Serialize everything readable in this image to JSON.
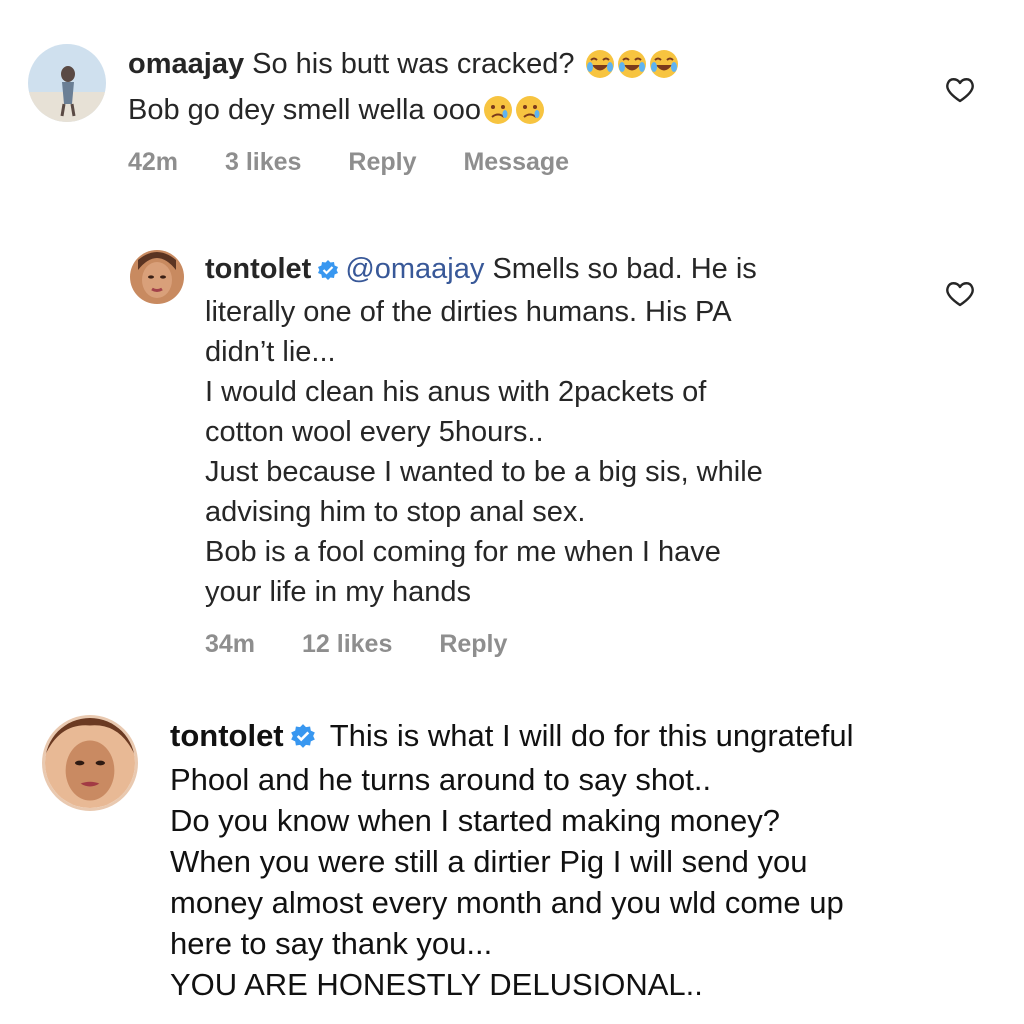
{
  "comments": [
    {
      "username": "omaajay",
      "lines": [
        "So his butt was cracked?",
        "Bob go dey smell wella ooo"
      ],
      "emoji_line1": [
        "joy-emoji",
        "joy-emoji",
        "joy-emoji"
      ],
      "emoji_line2": [
        "crying-emoji",
        "crying-emoji"
      ],
      "time": "42m",
      "likes": "3 likes",
      "reply": "Reply",
      "message": "Message"
    },
    {
      "username": "tontolet",
      "mention": "@omaajay",
      "first_line_rest": "Smells so bad. He is",
      "lines": [
        "literally one of the dirties humans. His PA",
        "didn’t lie...",
        "I would clean his anus with 2packets of",
        "cotton wool every 5hours..",
        "Just because I wanted to be a big sis, while",
        "advising him to stop anal sex.",
        "Bob is a fool coming for me when I have",
        "your life in my hands"
      ],
      "time": "34m",
      "likes": "12 likes",
      "reply": "Reply"
    },
    {
      "username": "tontolet",
      "first_line_rest": "This is what I will do for this ungrateful",
      "lines": [
        "Phool and he turns around to say shot..",
        "Do you know when I started making money?",
        "When you were still a dirtier Pig I will send you",
        "money almost every month and you wld come up",
        "here to say thank you...",
        "YOU ARE HONESTLY DELUSIONAL.."
      ]
    }
  ],
  "colors": {
    "verified": "#3897f0",
    "meta": "#8e8e8e",
    "text": "#262626"
  }
}
